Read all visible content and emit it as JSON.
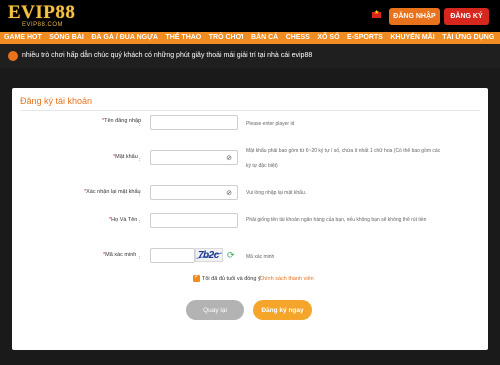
{
  "header": {
    "logo_text": "EVIP88",
    "logo_sub": "EVIP88.COM",
    "login_label": "ĐĂNG NHẬP",
    "register_label": "ĐĂNG KÝ"
  },
  "nav": {
    "items": [
      "GAME HOT",
      "SÒNG BÀI",
      "ĐÁ GÀ / ĐUA NGỰA",
      "THỂ THAO",
      "TRÒ CHƠI",
      "BẮN CÁ",
      "CHESS",
      "XỔ SỐ",
      "E-SPORTS",
      "KHUYẾN MÃI",
      "TẢI ỨNG DỤNG"
    ]
  },
  "marquee": {
    "text": "nhiều trò chơi hấp dẫn chúc quý khách có những phút giây thoải mái giải trí tại nhà cái evip88"
  },
  "form": {
    "title": "Đăng ký tài khoản",
    "username_label": "Tên đăng nhập",
    "username_hint": "Please enter player id",
    "password_label": "Mật khẩu",
    "password_hint_line1": "Mật khẩu phải bao gồm từ 6~20 ký tự / số, chứa ít nhất 1 chữ hoa (Có thể bao gồm các",
    "password_hint_line2": "ký tự đặc biệt)",
    "confirm_label": "Xác nhận lại mật khẩu",
    "confirm_hint": "Vui lòng nhập lại mật khẩu.",
    "fullname_label": "Họ Và Tên",
    "fullname_hint": "Phải giống tên tài khoản ngân hàng của bạn, nếu không bạn sẽ không thể rút tiền",
    "captcha_label": "Mã xác minh",
    "captcha_code": "7b2c",
    "captcha_hint": "Mã xác minh",
    "agree_text": "Tôi đã đủ tuổi và đồng ý",
    "agree_link": "Chính sách thành viên",
    "back_label": "Quay lại",
    "submit_label": "Đăng ký ngay",
    "colon": ":"
  },
  "colors": {
    "accent": "#f08c21",
    "login_btn": "#e8731c",
    "register_btn": "#d6271e",
    "submit_btn": "#f4a52a",
    "back_btn": "#b3b3b3"
  },
  "icons": {
    "password_toggle": "eye-off-icon",
    "refresh": "refresh-icon",
    "speaker": "speaker-icon",
    "flag": "vietnam-flag-icon"
  }
}
